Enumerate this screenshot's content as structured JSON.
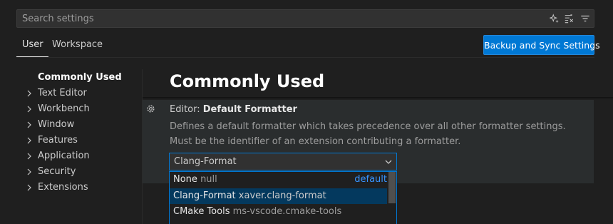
{
  "search": {
    "placeholder": "Search settings"
  },
  "search_actions": [
    "filter-sparkle-icon",
    "clear-filter-icon",
    "filter-icon"
  ],
  "tabs": [
    {
      "label": "User"
    },
    {
      "label": "Workspace"
    }
  ],
  "sync_button": {
    "label": "Backup and Sync Settings"
  },
  "toc": {
    "items": [
      {
        "label": "Commonly Used"
      },
      {
        "label": "Text Editor"
      },
      {
        "label": "Workbench"
      },
      {
        "label": "Window"
      },
      {
        "label": "Features"
      },
      {
        "label": "Application"
      },
      {
        "label": "Security"
      },
      {
        "label": "Extensions"
      }
    ]
  },
  "section": {
    "title": "Commonly Used"
  },
  "setting": {
    "category": "Editor: ",
    "name": "Default Formatter",
    "description": "Defines a default formatter which takes precedence over all other formatter settings. Must be the identifier of an extension contributing a formatter.",
    "value": "Clang-Format"
  },
  "dropdown": {
    "options": [
      {
        "name": "None",
        "id": "null",
        "tag": "default"
      },
      {
        "name": "Clang-Format",
        "id": "xaver.clang-format"
      },
      {
        "name": "CMake Tools",
        "id": "ms-vscode.cmake-tools"
      }
    ]
  },
  "colors": {
    "accent": "#0078d4",
    "link": "#3794ff",
    "selected_option": "#04395e"
  }
}
